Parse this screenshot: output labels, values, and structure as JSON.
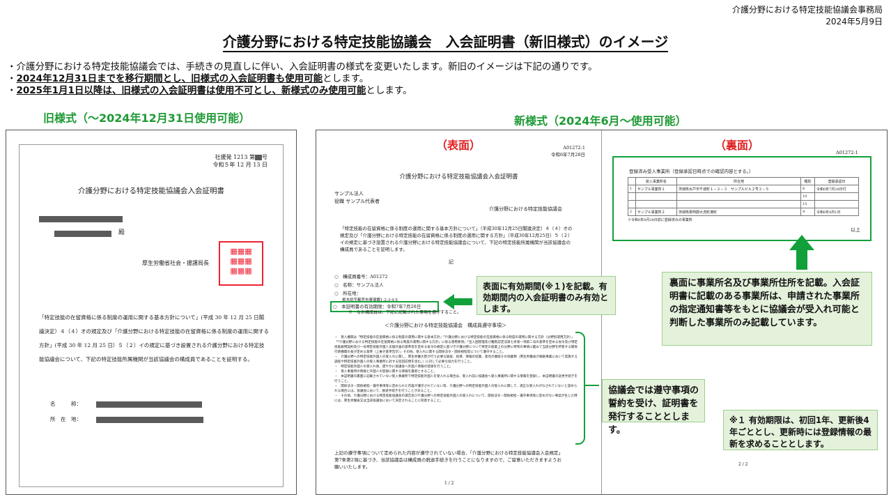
{
  "header": {
    "org": "介護分野における特定技能協議会事務局",
    "date": "2024年5月9日"
  },
  "title": "介護分野における特定技能協議会　入会証明書（新旧様式）のイメージ",
  "bullets": [
    {
      "prefix": "・",
      "text": "介護分野における特定技能協議会では、手続きの見直しに伴い、入会証明書の様式を変更いたします。新旧のイメージは下記の通りです。",
      "strong": "",
      "rest": ""
    },
    {
      "prefix": "・",
      "text": "",
      "strong": "2024年12月31日までを移行期間とし、旧様式の入会証明書も使用可能",
      "rest": "とします。"
    },
    {
      "prefix": "・",
      "text": "",
      "strong": "2025年1月1日以降は、旧様式の入会証明書は使用不可とし、新様式のみ使用可能",
      "rest": "とします。"
    }
  ],
  "old": {
    "heading": "旧様式（〜2024年12月31日使用可能）",
    "docno": "社援発 1213 第",
    "docno_suffix": "号",
    "date": "令和５年 12 月 13 日",
    "title": "介護分野における特定技能協議会入会証明書",
    "honorific": "殿",
    "issuer": "厚生労働省社会・援護局長",
    "body": "「特定技能の在留資格に係る制度の運用に関する基本方針について」(平成 30 年 12 月 25 日閣議決定）４（４）オの規定及び「介護分野における特定技能の在留資格に係る制度の運用に関する方針」(平成 30 年 12 月 25 日）５（２）イの規定に基づき設置される介護分野における特定技能協議会について、下記の特定技能所属機関が当該協議会の構成員であることを証明する。",
    "name_label": "名　　　称：",
    "addr_label": "所　在　地："
  },
  "new": {
    "heading": "新様式（2024年6月〜使用可能）",
    "front": {
      "label": "（表面）",
      "docno": "A01272-1",
      "date": "令和6年7月28日",
      "title": "介護分野における特定技能協議会入会証明書",
      "corp": "サンプル法人",
      "rep": "役職 サンプル代表者",
      "issuer": "介護分野における特定技能協議会",
      "body": "「特定技能の在留資格に係る制度の運用に関する基本方針について」（平成30年12月25日閣議決定）４（４）オの規定及び「介護分野における特定技能の在留資格に係る制度の運用に関する方針」（平成30年12月25日）５（２）イの規定に基づき設置される介護分野における特定技能協議会について、下記の特定技能所属機関が当該協議会の構成員であることを証明します。",
      "ki": "記",
      "items": [
        "○　構成員番号：A01272",
        "○　名称：サンプル法人",
        "○　所在地：",
        "　　栃木県宇都宮市東宿郷1-2-3-4-5"
      ],
      "validity": "○　本証明書の有効期限：令和7年7月28日",
      "note": "※　なお構成員は、下記に記載された事項を遵守すること。",
      "rules_title": "＜介護分野における特定技能協議会　構成員遵守事項＞",
      "rules": [
        "・　受入機関は「特定技能の在留資格に係る制度の運用に関する基本方針」「介護分野における特定技能の在留資格に係る制度の運用に関する方針（分野別運用方針）」「「介護分野における特定技能の在留資格に係る制度の運用に関する方針」に係る運用要領」「出入国管理及び難民認定法第七条第一項第二号の基準を定める省令及び特定技能雇用契約及び一号特定技能外国人支援計画の基準等を定める省令の規定に基づき介護分野について特定の産業上の分野に特有の事情に鑑みて当該分野を所管する関係行政機関の長が定める基準（上乗せ基準告示）」その他、受入れに関する関係法令・関係規程等について遵守すること。",
        "・　介護分野への特定技能外国人の受入れに関し、厚生労働大臣が行う必要な調査、指導、情報の収集、意見の聴取その他業務（厚生労働省が補助事業において実施する調査や特定技能外国人の受入事業所に対する巡回訪問を含む。）に対して必要な協力を行うこと。",
        "・　特定技能外国人の受入れ後、遅やかに協議会へ外国人情報の登録を行うこと。",
        "・　受入事業所の情報と外国人の登録に関する情報を最新とすること。",
        "・　本証明書の裏面に記載されていない受入事業所で特定技能外国人を受入れる場合は、受入れ前に協議会へ受入事業所に関する情報を登録し、本証明書の変更手続きを行うこと。",
        "・　関係法令・関係規程・遵守事項等に定められた内容が遵守されていない等、介護分野への特定技能外国人の受入れに関して、適正な受入れがなされていないと認められる場合には、協議会において、脱退手続きを行うことがあること。",
        "・　その他、介護分野における特定技能協議会の運営及び介護分野への特定技能外国人の受入れについて、関係法令・関係規程・遵守事項等に定めがない事案が生じた時には、厚生労働省又は当該協議会において決定されることに同意すること。"
      ],
      "closing": "上記の遵守事項について定められた内容が遵守されていない場合、「介護分野における特定技能協議会入会規定」第7条第2項に基づき、当該協議会は構成員の脱退手続きを行うことになりますので、ご留意いただきますようお願いいたします。",
      "page": "1 / 2"
    },
    "back": {
      "label": "（裏面）",
      "docno": "A01272-1",
      "reg_title": "登録済み受入事業所（登録承認日時点での確認内容とする。）",
      "cols": [
        "",
        "受入事業所名",
        "所在地",
        "種別",
        "登録承認日"
      ],
      "rows": [
        [
          "1",
          "サンプル事業所１",
          "茨城県水戸市千波町１－２－３　サンプルビル２号２－５",
          "6",
          "令和6年7月28日付"
        ],
        [
          "",
          "",
          "",
          "10",
          ""
        ],
        [
          "",
          "",
          "",
          "15",
          ""
        ],
        [
          "2",
          "サンプル事業所２",
          "茨城県那珂郡大洗町港町",
          "4",
          "令和6年4月1日"
        ]
      ],
      "reg_note": "※令和6年8月28日前に登録済みの事業所",
      "ijo": "以上",
      "page": "2 / 2"
    }
  },
  "callouts": {
    "validity": "表面に有効期間(※１)を記載。有効期間内の入会証明書のみ有効とします。",
    "back": "裏面に事業所名及び事業所住所を記載。入会証明書に記載のある事業所は、申請された事業所の指定通知書等をもとに協議会が受入れ可能と判断した事業所のみ記載しています。",
    "rules": "協議会では遵守事項の誓約を受け、証明書を発行することとします。",
    "note": "※１ 有効期限は、初回1年、更新後4年ごととし、更新時には登録情報の最新を求めることとします。"
  }
}
